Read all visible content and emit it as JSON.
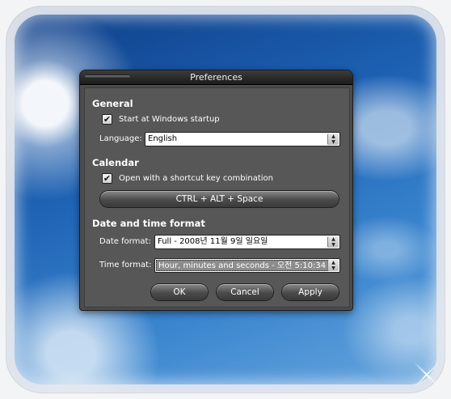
{
  "window": {
    "title": "Preferences"
  },
  "general": {
    "heading": "General",
    "startup_label": "Start at Windows startup",
    "startup_checked": true,
    "language_label": "Language:",
    "language_value": "English"
  },
  "calendar": {
    "heading": "Calendar",
    "shortcut_label": "Open with a shortcut key combination",
    "shortcut_checked": true,
    "shortcut_value": "CTRL + ALT + Space"
  },
  "datetime": {
    "heading": "Date and time format",
    "date_label": "Date format:",
    "date_value": "Full - 2008년 11월 9일 일요일",
    "time_label": "Time format:",
    "time_value": "Hour, minutes and seconds - 오전 5:10:34"
  },
  "buttons": {
    "ok": "OK",
    "cancel": "Cancel",
    "apply": "Apply"
  },
  "icons": {
    "checkmark": "✔",
    "spin_up": "▲",
    "spin_down": "▼"
  }
}
